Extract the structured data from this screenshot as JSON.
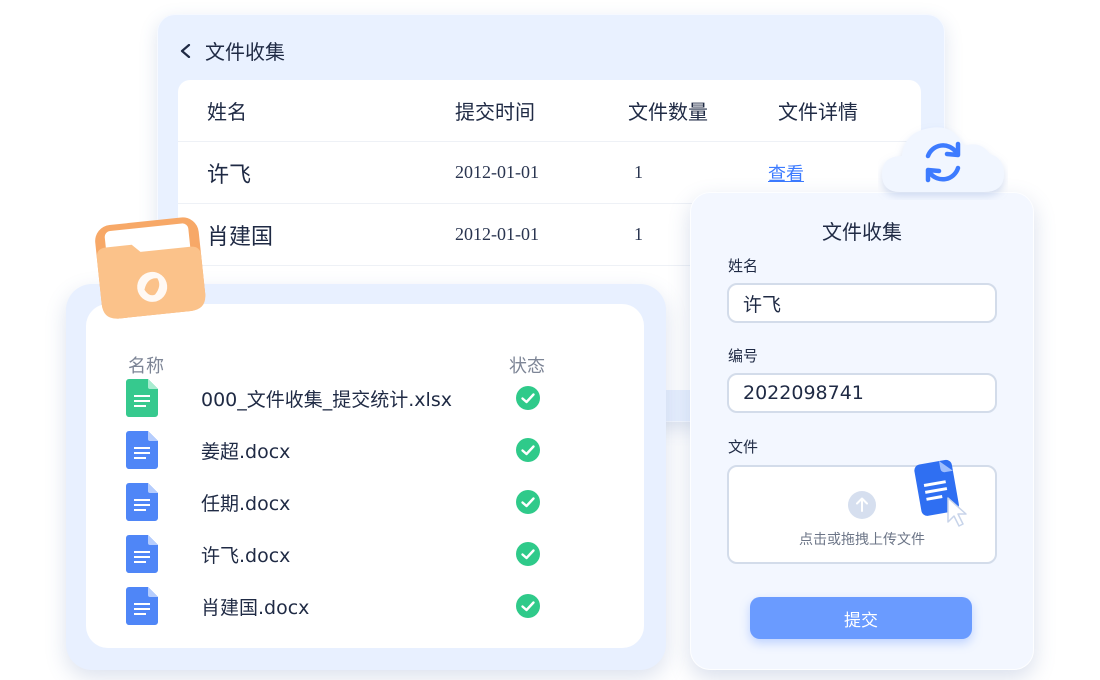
{
  "colors": {
    "accent": "#3d7bff",
    "submit": "#6a9bff",
    "success": "#2fca8a",
    "doc_blue": "#4f86f7",
    "xlsx_green": "#36c98e",
    "folder": "#fbc28a"
  },
  "submissions": {
    "title": "文件收集",
    "back_icon": "chevron-left-icon",
    "columns": [
      "姓名",
      "提交时间",
      "文件数量",
      "文件详情"
    ],
    "rows": [
      {
        "name": "许飞",
        "time": "2012-01-01",
        "count": "1",
        "detail": "查看"
      },
      {
        "name": "肖建国",
        "time": "2012-01-01",
        "count": "1",
        "detail": ""
      }
    ]
  },
  "file_list": {
    "col_name": "名称",
    "col_status": "状态",
    "files": [
      {
        "name": "000_文件收集_提交统计.xlsx",
        "type": "xlsx",
        "status": "success"
      },
      {
        "name": "姜超.docx",
        "type": "docx",
        "status": "success"
      },
      {
        "name": "任期.docx",
        "type": "docx",
        "status": "success"
      },
      {
        "name": "许飞.docx",
        "type": "docx",
        "status": "success"
      },
      {
        "name": "肖建国.docx",
        "type": "docx",
        "status": "success"
      }
    ]
  },
  "form": {
    "title": "文件收集",
    "name_label": "姓名",
    "name_value": "许飞",
    "id_label": "编号",
    "id_value": "2022098741",
    "file_label": "文件",
    "upload_text": "点击或拖拽上传文件",
    "submit_label": "提交"
  }
}
